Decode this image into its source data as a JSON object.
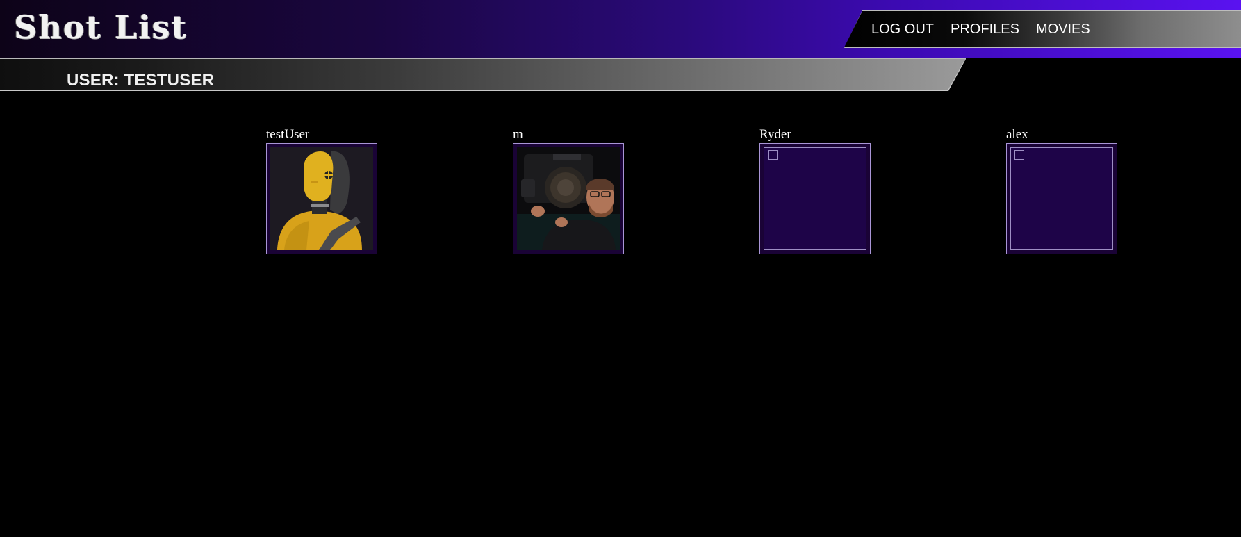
{
  "header": {
    "logo": "Shot List",
    "nav": {
      "logout": "LOG OUT",
      "profiles": "PROFILES",
      "movies": "MOVIES"
    }
  },
  "user_bar": {
    "title": "USER: TESTUSER"
  },
  "profiles": [
    {
      "name": "testUser",
      "avatar": "crash-test-dummy-photo"
    },
    {
      "name": "m",
      "avatar": "man-with-film-camera-photo"
    },
    {
      "name": "Ryder",
      "avatar": "broken-image-icon"
    },
    {
      "name": "alex",
      "avatar": "broken-image-icon"
    }
  ],
  "colors": {
    "accent": "#5a12f0",
    "frame_border": "#a995d6",
    "frame_bg": "#1a0336"
  }
}
